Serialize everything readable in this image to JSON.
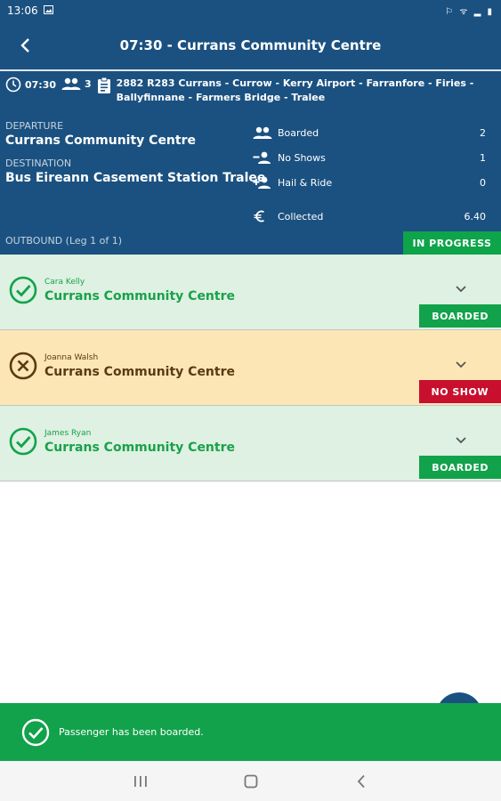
{
  "status_bar": {
    "time": "13:06",
    "system_icons": "⚐ ᯤ ▂ ▮"
  },
  "app_bar": {
    "title": "07:30 - Currans Community Centre"
  },
  "trip": {
    "time": "07:30",
    "passenger_count": "3",
    "route": "2882 R283 Currans - Currow - Kerry Airport - Farranfore - Firies - Ballyfinnane - Farmers Bridge - Tralee"
  },
  "departure": {
    "label": "DEPARTURE",
    "value": "Currans Community Centre"
  },
  "destination": {
    "label": "DESTINATION",
    "value": "Bus Eireann Casement Station Tralee"
  },
  "stats": {
    "boarded": {
      "label": "Boarded",
      "value": "2"
    },
    "no_shows": {
      "label": "No Shows",
      "value": "1"
    },
    "hail_ride": {
      "label": "Hail & Ride",
      "value": "0"
    },
    "collected": {
      "label": "Collected",
      "value": "6.40"
    }
  },
  "leg": {
    "label": "OUTBOUND (Leg 1 of 1)",
    "status": "IN PROGRESS"
  },
  "passengers": [
    {
      "name": "Cara Kelly",
      "location": "Currans Community Centre",
      "status": "BOARDED"
    },
    {
      "name": "Joanna Walsh",
      "location": "Currans Community Centre",
      "status": "NO SHOW"
    },
    {
      "name": "James Ryan",
      "location": "Currans Community Centre",
      "status": "BOARDED"
    }
  ],
  "snackbar": {
    "message": "Passenger has been boarded."
  },
  "colors": {
    "primary": "#1b5180",
    "success": "#12a24b",
    "danger": "#c8102e",
    "boarded_bg": "#def1e2",
    "noshow_bg": "#fde6b6"
  }
}
